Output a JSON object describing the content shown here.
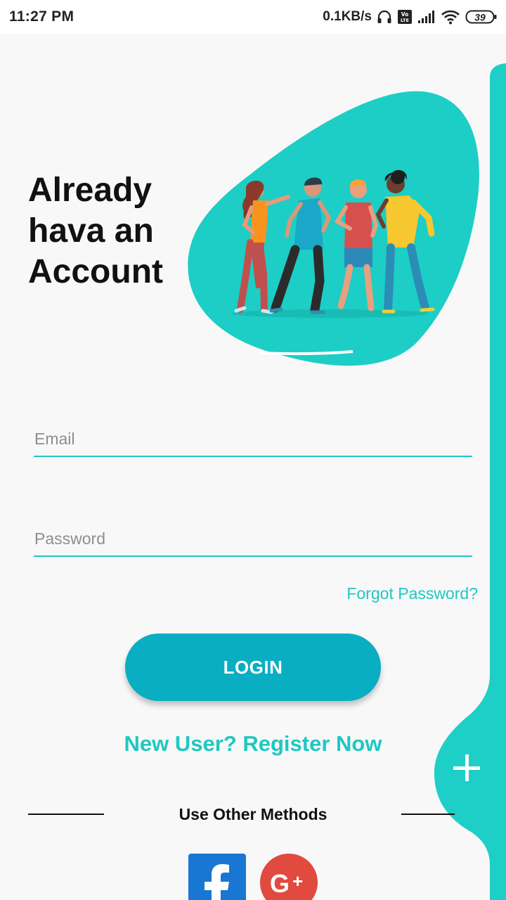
{
  "status_bar": {
    "time": "11:27 PM",
    "network_speed": "0.1KB/s",
    "battery_level": "39",
    "icons": [
      "headset-icon",
      "volte-icon",
      "signal-icon",
      "wifi-icon",
      "battery-icon"
    ]
  },
  "header": {
    "title_line1": "Already",
    "title_line2": "hava an",
    "title_line3": "Account",
    "illustration": "group-of-friends-illustration"
  },
  "form": {
    "email_placeholder": "Email",
    "password_placeholder": "Password",
    "forgot_password": "Forgot Password?",
    "login_label": "LOGIN"
  },
  "register_link": "New User? Register Now",
  "other_methods": {
    "label": "Use Other Methods",
    "providers": [
      "facebook-icon",
      "google-plus-icon"
    ]
  },
  "fab_icon": "plus-icon",
  "colors": {
    "accent": "#1ec8c2",
    "login_button": "#09aec2",
    "facebook": "#1877d2",
    "google": "#e04a3f",
    "background": "#f8f8f8"
  }
}
